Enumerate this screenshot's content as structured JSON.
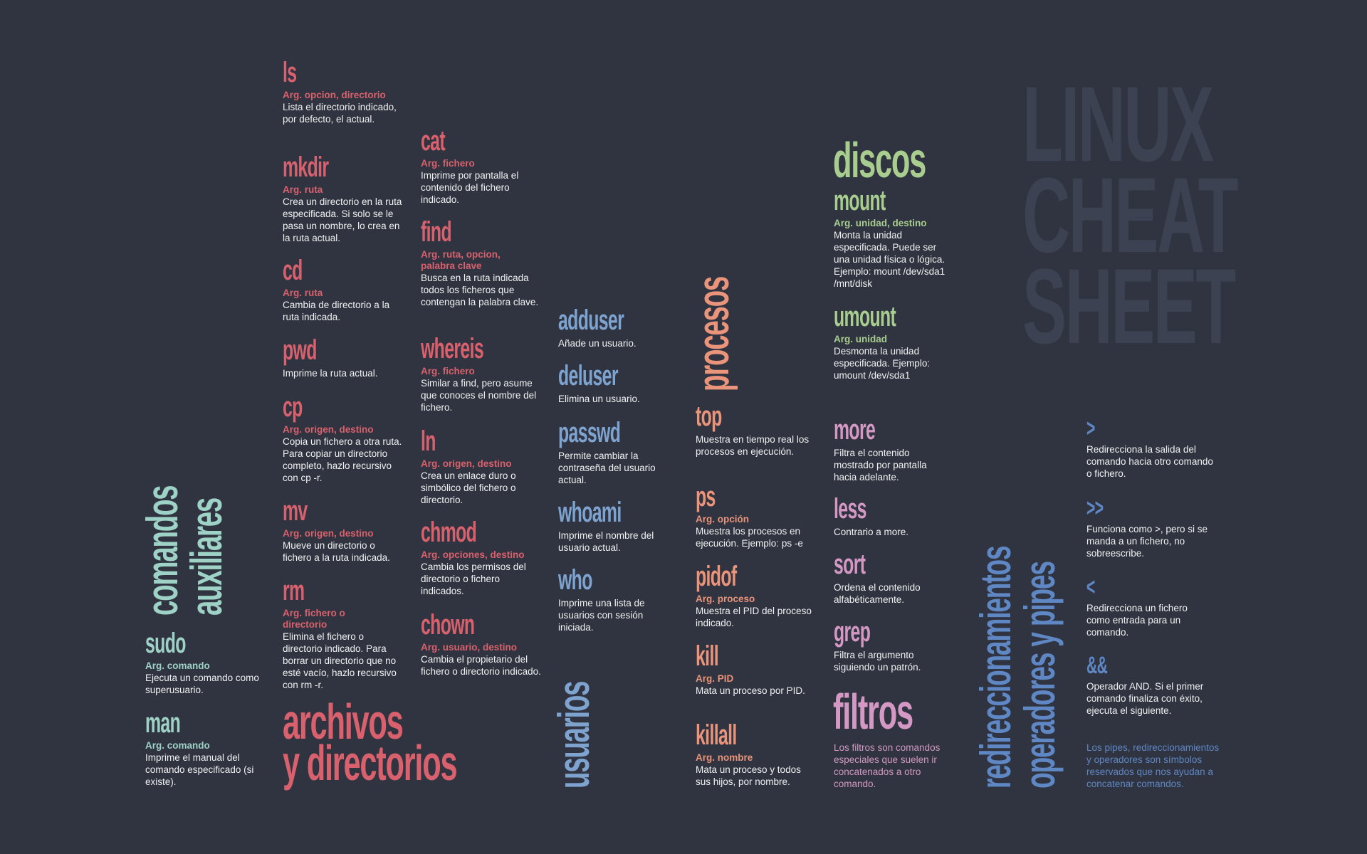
{
  "title": {
    "line1": "LINUX",
    "line2": "CHEAT",
    "line3": "SHEET"
  },
  "sections": {
    "auxiliares": {
      "line1": "comandos",
      "line2": "auxiliares",
      "color": "#9fd2c6"
    },
    "archivos": {
      "line1": "archivos",
      "line2": "y directorios",
      "color": "#d9616d"
    },
    "usuarios": {
      "label": "usuarios",
      "color": "#7ea3cf"
    },
    "procesos": {
      "label": "procesos",
      "color": "#e9947b"
    },
    "discos": {
      "label": "discos",
      "color": "#a8cd8e"
    },
    "filtros": {
      "label": "filtros",
      "color": "#d398c3",
      "note": "Los filtros son comandos especiales que suelen ir concatenados a otro comando."
    },
    "redirecciones": {
      "line1": "redireccionamientos",
      "line2": "operadores y pipes",
      "color": "#5f87c4",
      "note": "Los pipes, redireccionamientos y operadores son símbolos reservados que nos ayudan a concatenar comandos."
    }
  },
  "commands": {
    "sudo": {
      "name": "sudo",
      "arg": "Arg. comando",
      "desc": "Ejecuta un comando como superusuario."
    },
    "man": {
      "name": "man",
      "arg": "Arg. comando",
      "desc": "Imprime el manual del comando especificado (si existe)."
    },
    "ls": {
      "name": "ls",
      "arg": "Arg. opcion, directorio",
      "desc": "Lista el directorio indicado, por defecto, el actual."
    },
    "mkdir": {
      "name": "mkdir",
      "arg": "Arg. ruta",
      "desc": "Crea un directorio en la ruta especificada. Si solo se le pasa un nombre, lo crea en la ruta actual."
    },
    "cd": {
      "name": "cd",
      "arg": "Arg. ruta",
      "desc": "Cambia de directorio a la ruta indicada."
    },
    "pwd": {
      "name": "pwd",
      "desc": "Imprime la ruta actual."
    },
    "cp": {
      "name": "cp",
      "arg": "Arg. origen, destino",
      "desc": "Copia un fichero a otra ruta. Para copiar un directorio completo, hazlo recursivo con cp -r."
    },
    "mv": {
      "name": "mv",
      "arg": "Arg. origen, destino",
      "desc": "Mueve un directorio o fichero a la ruta indicada."
    },
    "rm": {
      "name": "rm",
      "arg": "Arg. fichero o directorio",
      "desc": "Elimina el fichero o directorio indicado. Para borrar un directorio que no esté vacío, hazlo recursivo con rm -r."
    },
    "cat": {
      "name": "cat",
      "arg": "Arg. fichero",
      "desc": "Imprime por pantalla el contenido del fichero indicado."
    },
    "find": {
      "name": "find",
      "arg": "Arg. ruta, opcion, palabra clave",
      "desc": "Busca en la ruta indicada todos los ficheros que contengan la palabra clave."
    },
    "whereis": {
      "name": "whereis",
      "arg": "Arg. fichero",
      "desc": "Similar a find, pero asume que conoces el nombre del fichero."
    },
    "ln": {
      "name": "ln",
      "arg": "Arg. origen, destino",
      "desc": "Crea un enlace duro o simbólico del fichero o directorio."
    },
    "chmod": {
      "name": "chmod",
      "arg": "Arg. opciones, destino",
      "desc": "Cambia los permisos del directorio o fichero indicados."
    },
    "chown": {
      "name": "chown",
      "arg": "Arg. usuario, destino",
      "desc": "Cambia el propietario del fichero o directorio indicado."
    },
    "adduser": {
      "name": "adduser",
      "desc": "Añade un usuario."
    },
    "deluser": {
      "name": "deluser",
      "desc": "Elimina un usuario."
    },
    "passwd": {
      "name": "passwd",
      "desc": "Permite cambiar la contraseña del usuario actual."
    },
    "whoami": {
      "name": "whoami",
      "desc": "Imprime el nombre del usuario actual."
    },
    "who": {
      "name": "who",
      "desc": "Imprime una lista de usuarios con sesión iniciada."
    },
    "top": {
      "name": "top",
      "desc": "Muestra en tiempo real los procesos en ejecución."
    },
    "ps": {
      "name": "ps",
      "arg": "Arg. opción",
      "desc": "Muestra los procesos en ejecución. Ejemplo: ps -e"
    },
    "pidof": {
      "name": "pidof",
      "arg": "Arg. proceso",
      "desc": "Muestra el PID del proceso indicado."
    },
    "kill": {
      "name": "kill",
      "arg": "Arg. PID",
      "desc": "Mata un proceso por PID."
    },
    "killall": {
      "name": "killall",
      "arg": "Arg. nombre",
      "desc": "Mata un proceso y todos sus hijos, por nombre."
    },
    "mount": {
      "name": "mount",
      "arg": "Arg. unidad, destino",
      "desc": "Monta la unidad especificada. Puede ser una unidad física o lógica. Ejemplo: mount /dev/sda1 /mnt/disk"
    },
    "umount": {
      "name": "umount",
      "arg": "Arg. unidad",
      "desc": "Desmonta la unidad especificada. Ejemplo: umount /dev/sda1"
    },
    "more": {
      "name": "more",
      "desc": "Filtra el contenido mostrado por pantalla hacia adelante."
    },
    "less": {
      "name": "less",
      "desc": "Contrario a more."
    },
    "sort": {
      "name": "sort",
      "desc": "Ordena el contenido alfabéticamente."
    },
    "grep": {
      "name": "grep",
      "desc": "Filtra el argumento siguiendo un patrón."
    },
    "gt": {
      "name": ">",
      "desc": "Redirecciona la salida del comando hacia otro comando o fichero."
    },
    "gtgt": {
      "name": ">>",
      "desc": "Funciona como >, pero si se manda a un fichero, no sobreescribe."
    },
    "lt": {
      "name": "<",
      "desc": "Redirecciona un fichero como entrada para un comando."
    },
    "and": {
      "name": "&&",
      "desc": "Operador AND. Si el primer comando finaliza con éxito, ejecuta el siguiente."
    }
  }
}
